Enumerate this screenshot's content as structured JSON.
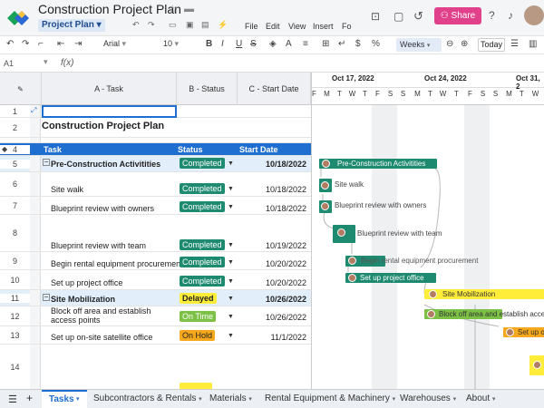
{
  "header": {
    "title": "Construction Project Plan",
    "view_button": "Project Plan",
    "menus": [
      "File",
      "Edit",
      "View",
      "Insert",
      "Fo"
    ],
    "share_label": "Share"
  },
  "toolbar": {
    "font": "Arial",
    "font_size": "10",
    "timescale": "Weeks",
    "today_label": "Today"
  },
  "formula_bar": {
    "cell_ref": "A1",
    "fx_label": "f(x)",
    "value": ""
  },
  "grid": {
    "columns": [
      "A - Task",
      "B - Status",
      "C - Start Date"
    ],
    "rows": [
      {
        "num": "1",
        "task": "",
        "status": "",
        "date": ""
      },
      {
        "num": "2",
        "task": "Construction Project Plan",
        "status": "",
        "date": ""
      },
      {
        "num": "4",
        "task": "Task",
        "status": "Status",
        "date": "Start Date"
      },
      {
        "num": "5",
        "task": "Pre-Construction Activitities",
        "status": "Completed",
        "date": "10/18/2022"
      },
      {
        "num": "6",
        "task": "Site walk",
        "status": "Completed",
        "date": "10/18/2022"
      },
      {
        "num": "7",
        "task": "Blueprint review with owners",
        "status": "Completed",
        "date": "10/18/2022"
      },
      {
        "num": "8",
        "task": "Blueprint review with team",
        "status": "Completed",
        "date": "10/19/2022"
      },
      {
        "num": "9",
        "task": "Begin rental equipment procurement",
        "status": "Completed",
        "date": "10/20/2022"
      },
      {
        "num": "10",
        "task": "Set up project office",
        "status": "Completed",
        "date": "10/20/2022"
      },
      {
        "num": "11",
        "task": "Site Mobilization",
        "status": "Delayed",
        "date": "10/26/2022"
      },
      {
        "num": "12",
        "task": "Block off area and establish access points",
        "status": "On Time",
        "date": "10/26/2022"
      },
      {
        "num": "13",
        "task": "Set up on-site satellite office",
        "status": "On Hold",
        "date": "11/1/2022"
      },
      {
        "num": "14",
        "task": "",
        "status": "",
        "date": ""
      }
    ]
  },
  "gantt": {
    "weeks": [
      "Oct 17, 2022",
      "Oct 24, 2022",
      "Oct 31, 2"
    ],
    "days": [
      "F",
      "S",
      "S",
      "M",
      "T",
      "W",
      "T",
      "F",
      "S",
      "S",
      "M",
      "T",
      "W",
      "T",
      "F",
      "S",
      "S",
      "M",
      "T",
      "W"
    ],
    "bars": [
      {
        "label": "Pre-Construction Activitities",
        "color": "#1e8a6f"
      },
      {
        "label": "Site walk",
        "color": "#1e8a6f"
      },
      {
        "label": "Blueprint review with owners",
        "color": "#1e8a6f"
      },
      {
        "label": "Blueprint review with team",
        "color": "#1e8a6f"
      },
      {
        "label": "Begin rental equipment procurement",
        "color": "#1e8a6f"
      },
      {
        "label": "Set up project office",
        "color": "#1e8a6f"
      },
      {
        "label": "Site Mobilization",
        "color": "#ffed3a"
      },
      {
        "label": "Block off area and establish access",
        "color": "#7cc045"
      },
      {
        "label": "Set up on",
        "color": "#f6a81c"
      }
    ]
  },
  "tabs": [
    "Tasks",
    "Subcontractors & Rentals",
    "Materials",
    "Rental Equipment & Machinery",
    "Warehouses",
    "About"
  ],
  "colors": {
    "completed": "#1e8a6f",
    "delayed": "#ffed3a",
    "on_time": "#7cc045",
    "on_hold": "#f6a81c",
    "header_blue": "#1f6fd1",
    "share": "#e0418a"
  }
}
